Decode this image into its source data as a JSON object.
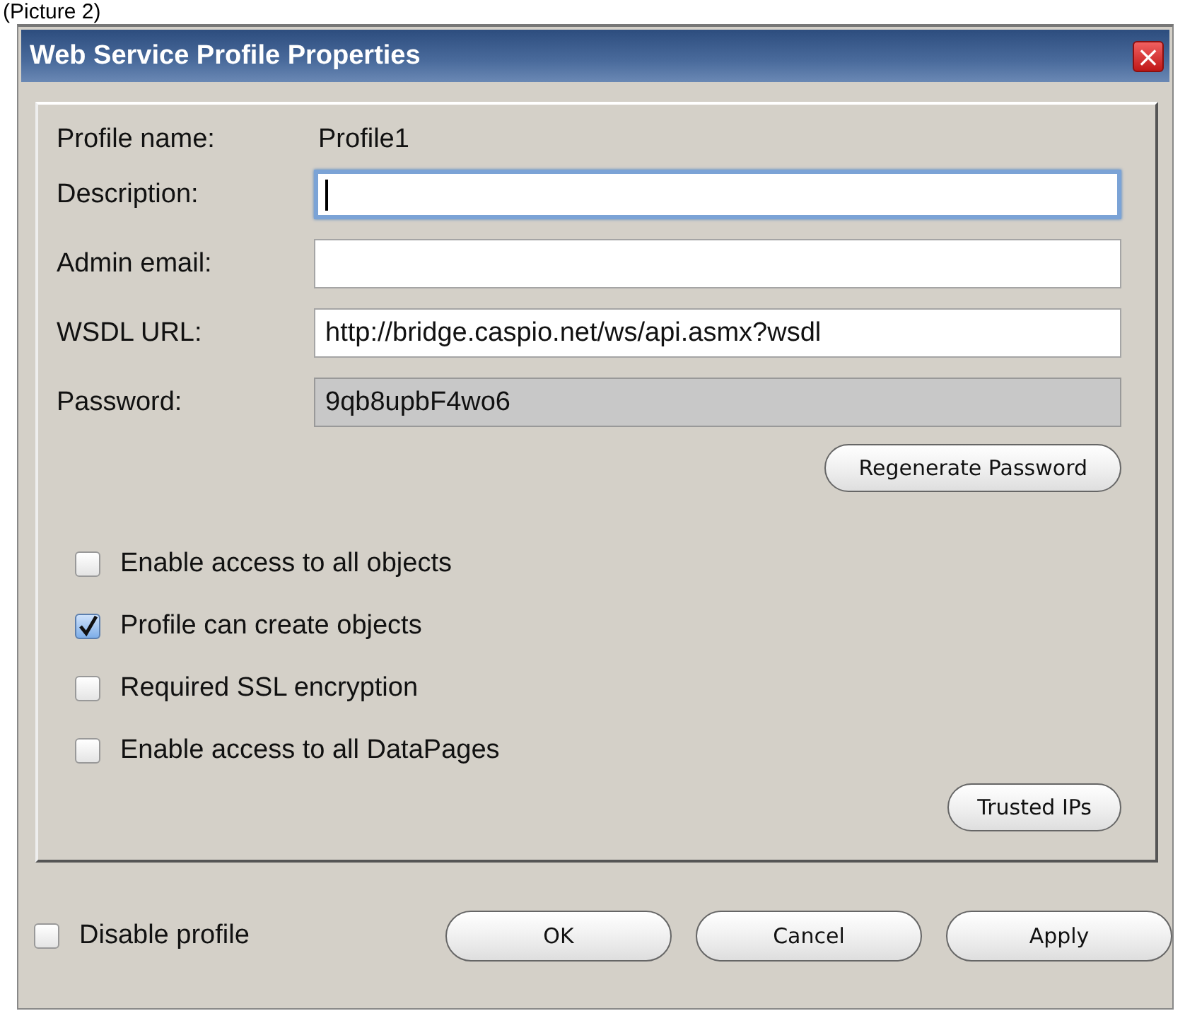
{
  "caption": "(Picture 2)",
  "window": {
    "title": "Web Service Profile Properties",
    "close": "×"
  },
  "profile_name": {
    "label": "Profile name:",
    "value": "Profile1"
  },
  "fields": [
    {
      "label": "Description:",
      "focused": true,
      "readonly": false
    },
    {
      "label": "Admin email:",
      "focused": false,
      "readonly": false
    },
    {
      "label": "WSDL URL:",
      "value": "http://bridge.caspio.net/ws/api.asmx?wsdl",
      "focused": false,
      "readonly": false
    },
    {
      "label": "Password:",
      "value": "9qb8upbF4wo6",
      "focused": false,
      "readonly": true
    }
  ],
  "regenerate_button": "Regenerate Password",
  "options": [
    {
      "label": "Enable access to all objects",
      "checked": false
    },
    {
      "label": "Profile can create objects",
      "checked": true
    },
    {
      "label": "Required SSL encryption",
      "checked": false
    },
    {
      "label": "Enable access to all DataPages",
      "checked": false
    }
  ],
  "trusted_button": "Trusted IPs",
  "disable_profile": {
    "label": "Disable profile",
    "checked": false
  },
  "buttons": [
    "OK",
    "Cancel",
    "Apply"
  ]
}
